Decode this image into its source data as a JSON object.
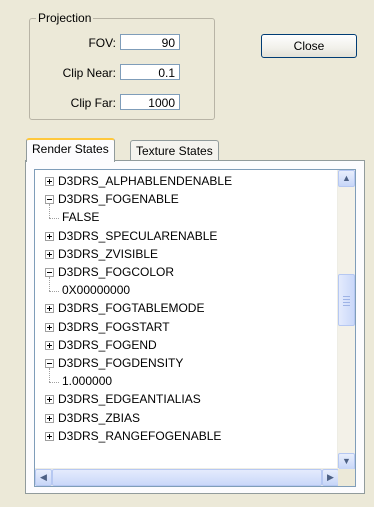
{
  "projection": {
    "group_title": "Projection",
    "fov_label": "FOV:",
    "fov_value": "90",
    "clip_near_label": "Clip Near:",
    "clip_near_value": "0.1",
    "clip_far_label": "Clip Far:",
    "clip_far_value": "1000"
  },
  "close_label": "Close",
  "tabs": [
    {
      "label": "Render States",
      "active": true
    },
    {
      "label": "Texture States",
      "active": false
    }
  ],
  "tree": {
    "items": [
      {
        "label": "D3DRS_ALPHABLENDENABLE",
        "state": "collapsed"
      },
      {
        "label": "D3DRS_FOGENABLE",
        "state": "expanded",
        "child": "FALSE"
      },
      {
        "label": "D3DRS_SPECULARENABLE",
        "state": "collapsed"
      },
      {
        "label": "D3DRS_ZVISIBLE",
        "state": "collapsed"
      },
      {
        "label": "D3DRS_FOGCOLOR",
        "state": "expanded",
        "child": "0X00000000"
      },
      {
        "label": "D3DRS_FOGTABLEMODE",
        "state": "collapsed"
      },
      {
        "label": "D3DRS_FOGSTART",
        "state": "collapsed"
      },
      {
        "label": "D3DRS_FOGEND",
        "state": "collapsed"
      },
      {
        "label": "D3DRS_FOGDENSITY",
        "state": "expanded",
        "child": "1.000000"
      },
      {
        "label": "D3DRS_EDGEANTIALIAS",
        "state": "collapsed"
      },
      {
        "label": "D3DRS_ZBIAS",
        "state": "collapsed"
      },
      {
        "label": "D3DRS_RANGEFOGENABLE",
        "state": "collapsed"
      }
    ]
  },
  "icons": {
    "scroll_up": "arrow-up-icon",
    "scroll_down": "arrow-down-icon",
    "scroll_left": "arrow-left-icon",
    "scroll_right": "arrow-right-icon"
  }
}
